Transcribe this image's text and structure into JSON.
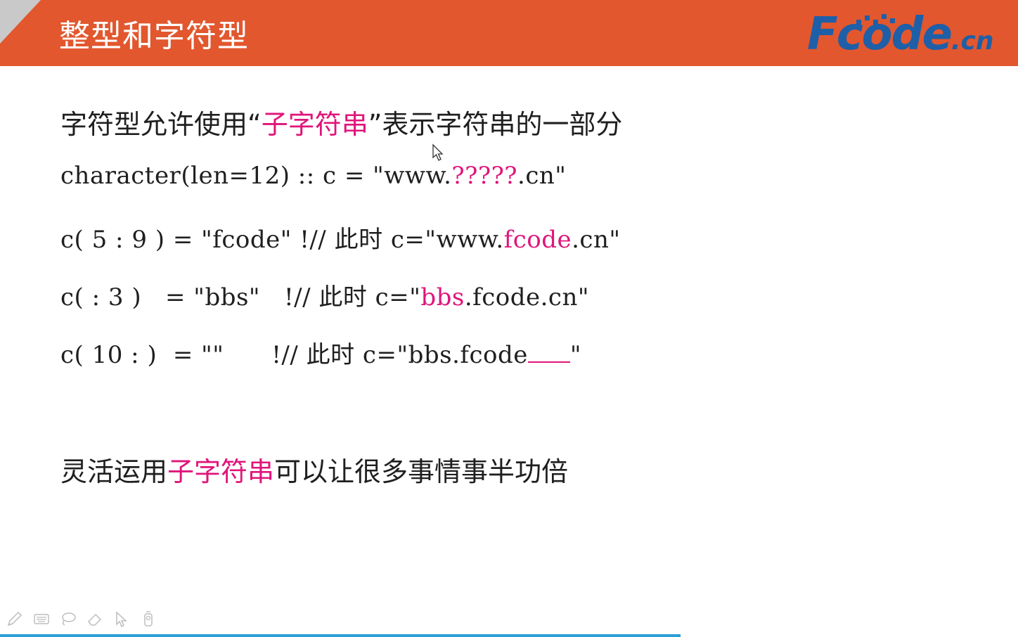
{
  "header": {
    "title": "整型和字符型",
    "logo_text": "Fcode.cn",
    "logo_main": "Fcode",
    "logo_suffix": ".cn"
  },
  "slide": {
    "line1": {
      "before": "字符型允许使用“",
      "highlight": "子字符串",
      "after": "”表示字符串的一部分"
    },
    "line2": {
      "before": "character(len=12) :: c = \"www.",
      "highlight": "?????",
      "after": ".cn\""
    },
    "line3": {
      "before": "c( 5 : 9 ) = \"fcode\" !// 此时 c=\"www.",
      "highlight": "fcode",
      "after": ".cn\""
    },
    "line4": {
      "before": "c( : 3 )   = \"bbs\"   !// 此时 c=\"",
      "highlight": "bbs",
      "after": ".fcode.cn\""
    },
    "line5": {
      "before": "c( 10 : )  = \"\"      !// 此时 c=\"bbs.fcode",
      "after": "\""
    },
    "line6": {
      "before": "灵活运用",
      "highlight": "子字符串",
      "after": "可以让很多事情事半功倍"
    }
  },
  "toolbar": {
    "icons": [
      "pen-icon",
      "keyboard-icon",
      "lasso-icon",
      "eraser-icon",
      "pointer-icon",
      "laser-pointer-icon"
    ]
  },
  "colors": {
    "header_bg": "#e2572e",
    "accent_pink": "#e0157a",
    "logo_blue": "#1e5fa8",
    "progress_blue": "#2d9fd8"
  }
}
